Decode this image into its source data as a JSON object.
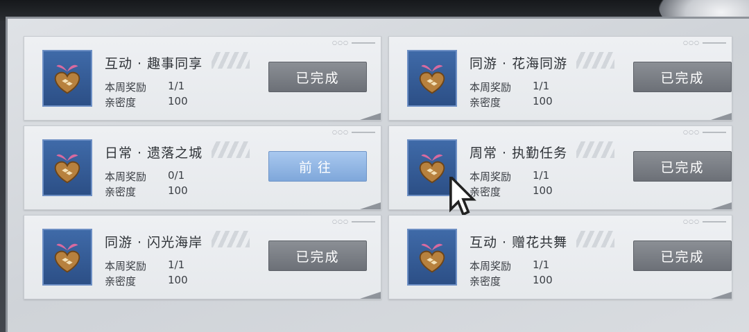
{
  "tasks": [
    {
      "title": "互动 · 趣事同享",
      "reward_label": "本周奖励",
      "reward_value": "1/1",
      "intimacy_label": "亲密度",
      "intimacy_value": "100",
      "button": "已完成",
      "status": "completed"
    },
    {
      "title": "同游 · 花海同游",
      "reward_label": "本周奖励",
      "reward_value": "1/1",
      "intimacy_label": "亲密度",
      "intimacy_value": "100",
      "button": "已完成",
      "status": "completed"
    },
    {
      "title": "日常 · 遗落之城",
      "reward_label": "本周奖励",
      "reward_value": "0/1",
      "intimacy_label": "亲密度",
      "intimacy_value": "100",
      "button": "前往",
      "status": "go"
    },
    {
      "title": "周常 · 执勤任务",
      "reward_label": "本周奖励",
      "reward_value": "1/1",
      "intimacy_label": "亲密度",
      "intimacy_value": "100",
      "button": "已完成",
      "status": "completed"
    },
    {
      "title": "同游 · 闪光海岸",
      "reward_label": "本周奖励",
      "reward_value": "1/1",
      "intimacy_label": "亲密度",
      "intimacy_value": "100",
      "button": "已完成",
      "status": "completed"
    },
    {
      "title": "互动 · 赠花共舞",
      "reward_label": "本周奖励",
      "reward_value": "1/1",
      "intimacy_label": "亲密度",
      "intimacy_value": "100",
      "button": "已完成",
      "status": "completed"
    }
  ],
  "icons": {
    "task_icon": "heart-sprout-icon"
  },
  "colors": {
    "completed_button": "#7a7e85",
    "go_button": "#8fb3e4",
    "icon_bg": "#335a96"
  }
}
